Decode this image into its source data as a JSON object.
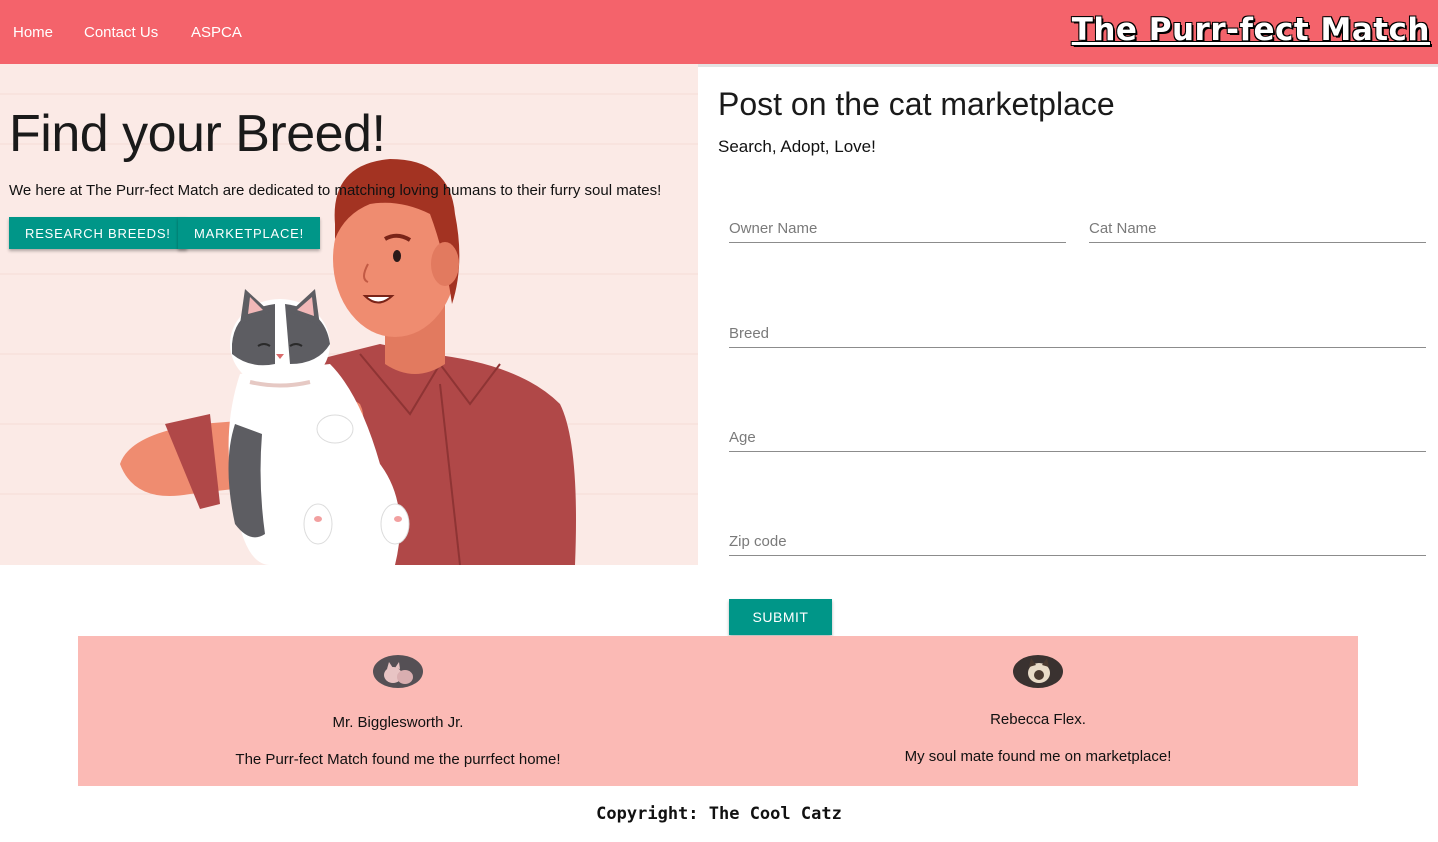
{
  "nav": {
    "links": [
      "Home",
      "Contact Us",
      "ASPCA"
    ],
    "brand": "The Purr-fect Match",
    "background": "#f4636b"
  },
  "hero": {
    "title": "Find your Breed!",
    "text": "We here at The Purr-fect Match are dedicated to matching loving humans to their furry soul mates!",
    "buttons": [
      "RESEARCH BREEDS!",
      "MARKETPLACE!"
    ],
    "background": "#fbeae6"
  },
  "form": {
    "title": "Post on the cat marketplace",
    "subtitle": "Search, Adopt, Love!",
    "fields": [
      {
        "placeholder": "Owner Name",
        "value": ""
      },
      {
        "placeholder": "Cat Name",
        "value": ""
      },
      {
        "placeholder": "Breed",
        "value": ""
      },
      {
        "placeholder": "Age",
        "value": ""
      },
      {
        "placeholder": "Zip code",
        "value": ""
      }
    ],
    "submit": "SUBMIT",
    "accent": "#009688"
  },
  "testimonials": [
    {
      "name": "Mr. Bigglesworth Jr.",
      "quote": "The Purr-fect Match found me the purrfect home!",
      "avatar": "hairless-cat-photo"
    },
    {
      "name": "Rebecca Flex.",
      "quote": "My soul mate found me on marketplace!",
      "avatar": "siamese-cat-photo"
    }
  ],
  "testimonials_background": "#fbbab5",
  "footer": {
    "text": "Copyright: The Cool Catz"
  }
}
